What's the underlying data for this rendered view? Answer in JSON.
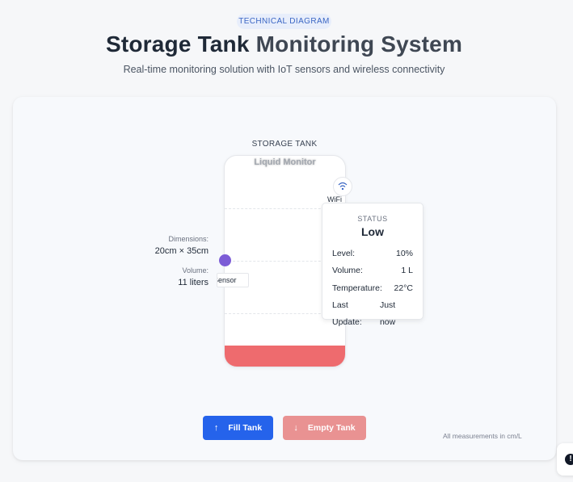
{
  "header": {
    "badge": "TECHNICAL DIAGRAM",
    "title_part1": "Storage Tank ",
    "title_part2": "Monitoring System",
    "subtitle": "Real-time monitoring solution with IoT sensors and wireless connectivity"
  },
  "tank": {
    "label": "STORAGE TANK",
    "name": "Liquid Monitor",
    "fill_fraction": 0.1,
    "liquid_color": "#ee6b6e",
    "wifi_label": "WiFi",
    "wifi_icon": "wifi-icon",
    "sensor_label": "Sensor",
    "sensor_color": "#7c5cd6"
  },
  "specs": {
    "dimensions_label": "Dimensions:",
    "dimensions_value": "20cm × 35cm",
    "volume_label": "Volume:",
    "volume_value": "11 liters"
  },
  "status": {
    "heading": "STATUS",
    "level_text": "Low",
    "rows": [
      {
        "label": "Level:",
        "value": "10%"
      },
      {
        "label": "Volume:",
        "value": "1 L"
      },
      {
        "label": "Temperature:",
        "value": "22°C"
      },
      {
        "label": "Last Update:",
        "value": "Just now"
      }
    ]
  },
  "controls": {
    "fill_label": "Fill Tank",
    "fill_icon": "arrow-up-icon",
    "fill_color": "#2563eb",
    "empty_label": "Empty Tank",
    "empty_icon": "arrow-down-icon",
    "empty_color": "#e99292"
  },
  "footer": {
    "note": "All measurements in cm/L",
    "help_icon": "help-icon"
  }
}
